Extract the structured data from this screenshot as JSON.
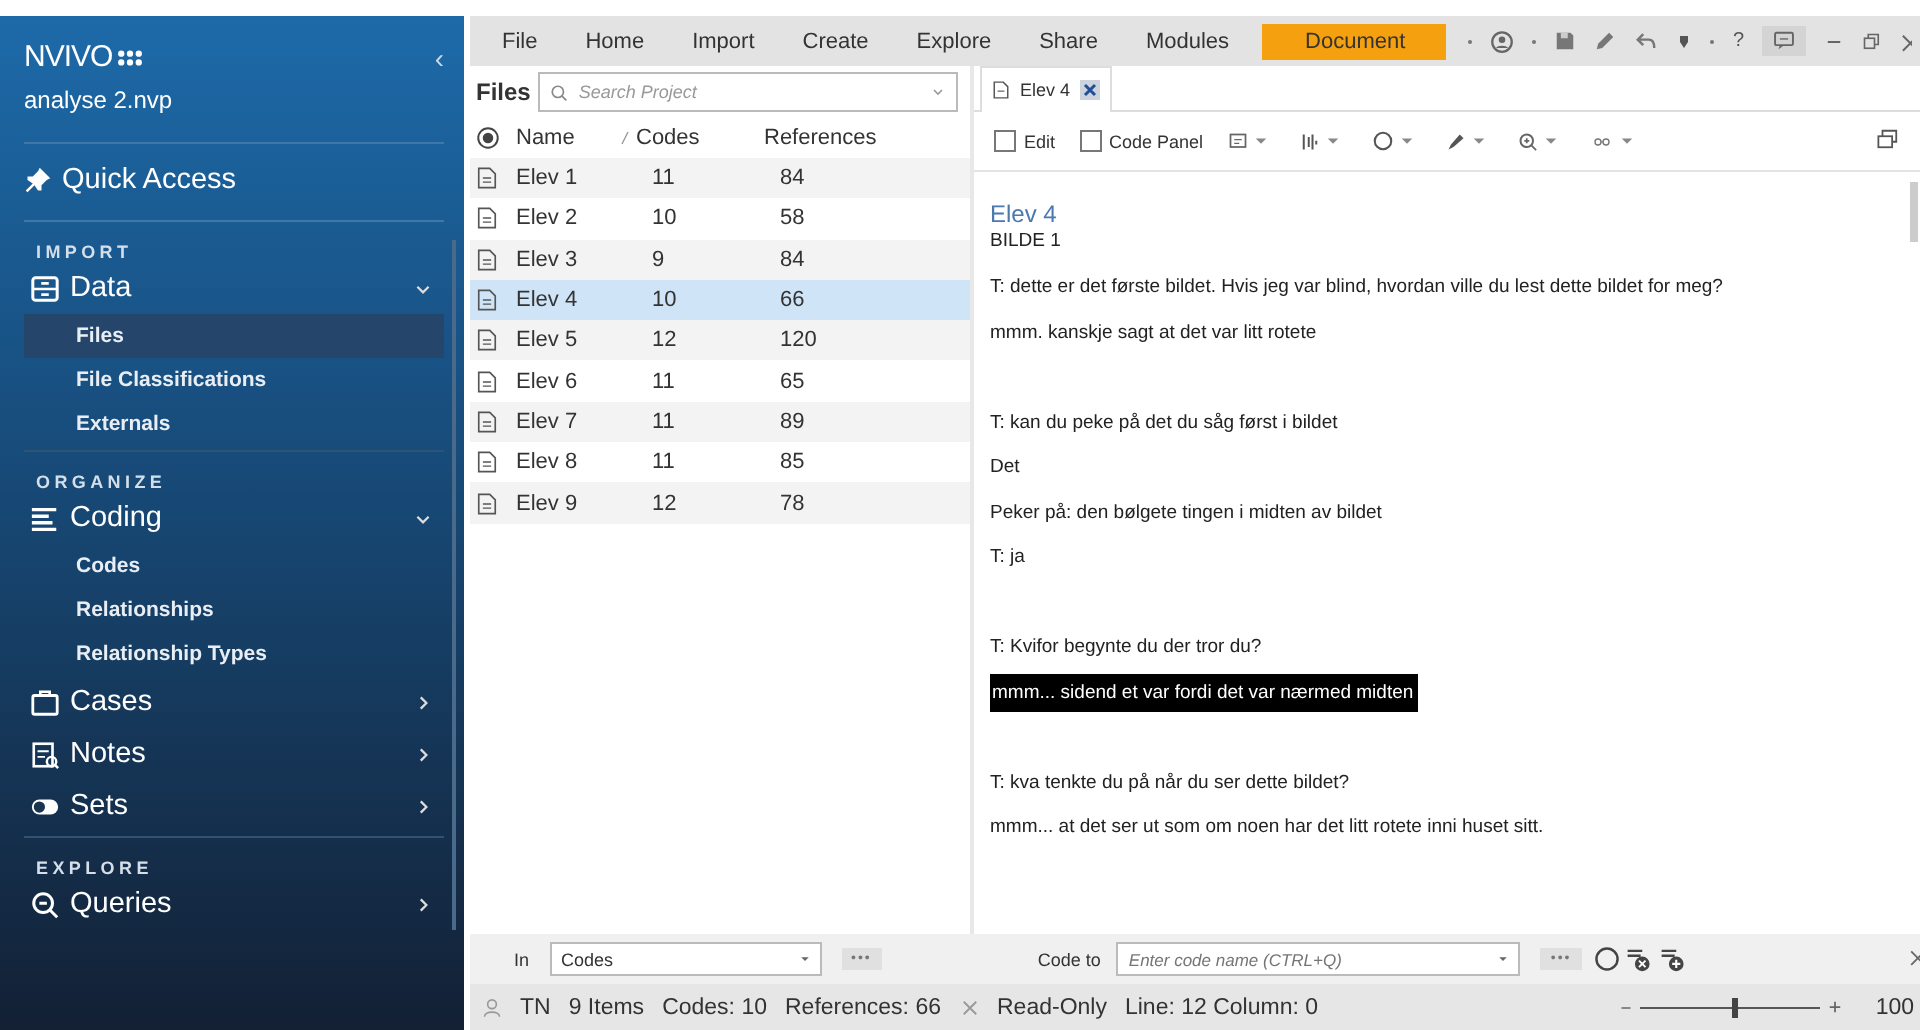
{
  "sidebar": {
    "logo": "NVIVO",
    "project": "analyse 2.nvp",
    "collapse": "‹",
    "quick_access": "Quick Access",
    "sections": [
      {
        "label": "IMPORT",
        "groups": [
          {
            "kind": "data",
            "label": "Data",
            "expanded": true,
            "children": [
              {
                "label": "Files",
                "selected": true
              },
              {
                "label": "File Classifications",
                "selected": false
              },
              {
                "label": "Externals",
                "selected": false
              }
            ]
          }
        ]
      },
      {
        "label": "ORGANIZE",
        "groups": [
          {
            "kind": "coding",
            "label": "Coding",
            "expanded": true,
            "children": [
              {
                "label": "Codes",
                "selected": false
              },
              {
                "label": "Relationships",
                "selected": false
              },
              {
                "label": "Relationship Types",
                "selected": false
              }
            ]
          },
          {
            "kind": "cases",
            "label": "Cases",
            "expanded": false
          },
          {
            "kind": "notes",
            "label": "Notes",
            "expanded": false
          },
          {
            "kind": "sets",
            "label": "Sets",
            "expanded": false
          }
        ]
      },
      {
        "label": "EXPLORE",
        "groups": [
          {
            "kind": "queries",
            "label": "Queries",
            "expanded": false
          }
        ]
      }
    ]
  },
  "ribbon": {
    "tabs": [
      {
        "label": "File",
        "selected": false
      },
      {
        "label": "Home",
        "selected": false
      },
      {
        "label": "Import",
        "selected": false
      },
      {
        "label": "Create",
        "selected": false
      },
      {
        "label": "Explore",
        "selected": false
      },
      {
        "label": "Share",
        "selected": false
      },
      {
        "label": "Modules",
        "selected": false
      },
      {
        "label": "Document",
        "selected": true
      }
    ],
    "help": "?"
  },
  "files": {
    "title": "Files",
    "search": {
      "placeholder": "Search Project"
    },
    "columns": [
      "Name",
      "Codes",
      "References"
    ],
    "rows": [
      {
        "name": "Elev 1",
        "codes": "11",
        "references": "84",
        "selected": false
      },
      {
        "name": "Elev 2",
        "codes": "10",
        "references": "58",
        "selected": false
      },
      {
        "name": "Elev 3",
        "codes": "9",
        "references": "84",
        "selected": false
      },
      {
        "name": "Elev 4",
        "codes": "10",
        "references": "66",
        "selected": true
      },
      {
        "name": "Elev 5",
        "codes": "12",
        "references": "120",
        "selected": false
      },
      {
        "name": "Elev 6",
        "codes": "11",
        "references": "65",
        "selected": false
      },
      {
        "name": "Elev 7",
        "codes": "11",
        "references": "89",
        "selected": false
      },
      {
        "name": "Elev 8",
        "codes": "11",
        "references": "85",
        "selected": false
      },
      {
        "name": "Elev 9",
        "codes": "12",
        "references": "78",
        "selected": false
      }
    ]
  },
  "document": {
    "tab": "Elev 4",
    "toolbar": {
      "edit": {
        "label": "Edit",
        "checked": false
      },
      "code_panel": {
        "label": "Code Panel",
        "checked": false
      }
    },
    "title": "Elev 4",
    "paragraphs": [
      {
        "kind": "text",
        "text": "BILDE 1",
        "highlighted": false
      },
      {
        "kind": "text",
        "text": "T: dette er det første bildet. Hvis jeg var blind, hvordan ville du lest dette bildet for meg?",
        "highlighted": false
      },
      {
        "kind": "text",
        "text": "mmm. kanskje sagt at det var litt rotete",
        "highlighted": false
      },
      {
        "kind": "blank"
      },
      {
        "kind": "text",
        "text": "T: kan du peke på det du såg først i bildet",
        "highlighted": false
      },
      {
        "kind": "text",
        "text": "Det",
        "highlighted": false
      },
      {
        "kind": "text",
        "text": "Peker på: den bølgete tingen i midten av bildet",
        "highlighted": false
      },
      {
        "kind": "text",
        "text": "T: ja",
        "highlighted": false
      },
      {
        "kind": "blank"
      },
      {
        "kind": "text",
        "text": "T: Kvifor begynte du der tror du?",
        "highlighted": false
      },
      {
        "kind": "text",
        "text": "mmm... sidend et var fordi det var nærmed midten",
        "highlighted": true
      },
      {
        "kind": "blank"
      },
      {
        "kind": "text",
        "text": "T: kva tenkte du på når du ser dette bildet?",
        "highlighted": false
      },
      {
        "kind": "text",
        "text": "mmm... at det ser ut som om noen har det litt rotete inni huset sitt.",
        "highlighted": false
      }
    ]
  },
  "coding_bar": {
    "in_label": "In",
    "in_value": "Codes",
    "code_to_label": "Code to",
    "code_to": {
      "placeholder": "Enter code name (CTRL+Q)"
    },
    "more": "•••"
  },
  "status_bar": {
    "user": "TN",
    "items": "9 Items",
    "codes": "Codes: 10",
    "references": "References: 66",
    "read_only": "Read-Only",
    "position": "Line: 12 Column: 0",
    "zoom": {
      "level": 0.52,
      "reading": "100"
    }
  }
}
